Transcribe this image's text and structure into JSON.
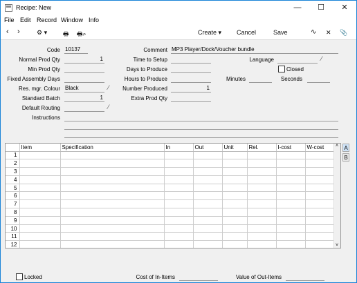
{
  "window": {
    "title": "Recipe: New",
    "minimize": "—",
    "maximize": "☐",
    "close": "✕"
  },
  "menu": [
    "File",
    "Edit",
    "Record",
    "Window",
    "Info"
  ],
  "toolbar": {
    "back": "‹",
    "forward": "›",
    "settings": "⚙ ▾",
    "print": "🖶",
    "print_preview": "🖶⌕",
    "create_label": "Create ▾",
    "cancel_label": "Cancel",
    "save_label": "Save",
    "graph": "∿",
    "expand": "✕",
    "attach": "📎"
  },
  "form": {
    "code_label": "Code",
    "code_value": "10137",
    "comment_label": "Comment",
    "comment_value": "MP3 Player/Dock/Voucher bundle",
    "normal_prod_qty_label": "Normal Prod Qty",
    "normal_prod_qty_value": "1",
    "time_to_setup_label": "Time to Setup",
    "time_to_setup_value": "",
    "language_label": "Language",
    "language_value": "",
    "min_prod_qty_label": "Min Prod Qty",
    "min_prod_qty_value": "",
    "days_to_produce_label": "Days to Produce",
    "days_to_produce_value": "",
    "closed_label": "Closed",
    "fixed_assembly_days_label": "Fixed Assembly Days",
    "fixed_assembly_days_value": "",
    "hours_to_produce_label": "Hours to Produce",
    "hours_to_produce_value": "",
    "minutes_label": "Minutes",
    "minutes_value": "",
    "seconds_label": "Seconds",
    "seconds_value": "",
    "res_mgr_colour_label": "Res. mgr. Colour",
    "res_mgr_colour_value": "Black",
    "number_produced_label": "Number Produced",
    "number_produced_value": "1",
    "standard_batch_label": "Standard Batch",
    "standard_batch_value": "1",
    "extra_prod_qty_label": "Extra Prod Qty",
    "extra_prod_qty_value": "",
    "default_routing_label": "Default Routing",
    "default_routing_value": "",
    "instructions_label": "Instructions"
  },
  "grid": {
    "columns": [
      "",
      "Item",
      "Specification",
      "In",
      "Out",
      "Unit",
      "Rel.",
      "I-cost",
      "W-cost"
    ],
    "row_numbers": [
      "1",
      "2",
      "3",
      "4",
      "5",
      "6",
      "7",
      "8",
      "9",
      "10",
      "11",
      "12"
    ],
    "tab_a": "A",
    "tab_b": "B"
  },
  "footer": {
    "locked_label": "Locked",
    "cost_in_items_label": "Cost of In-Items",
    "cost_in_items_value": "",
    "value_out_items_label": "Value of Out-Items",
    "value_out_items_value": ""
  },
  "colors": {
    "window_border": "#1883d7",
    "form_bg": "#f0f0f0",
    "tab_active": "#cfe3f7"
  }
}
